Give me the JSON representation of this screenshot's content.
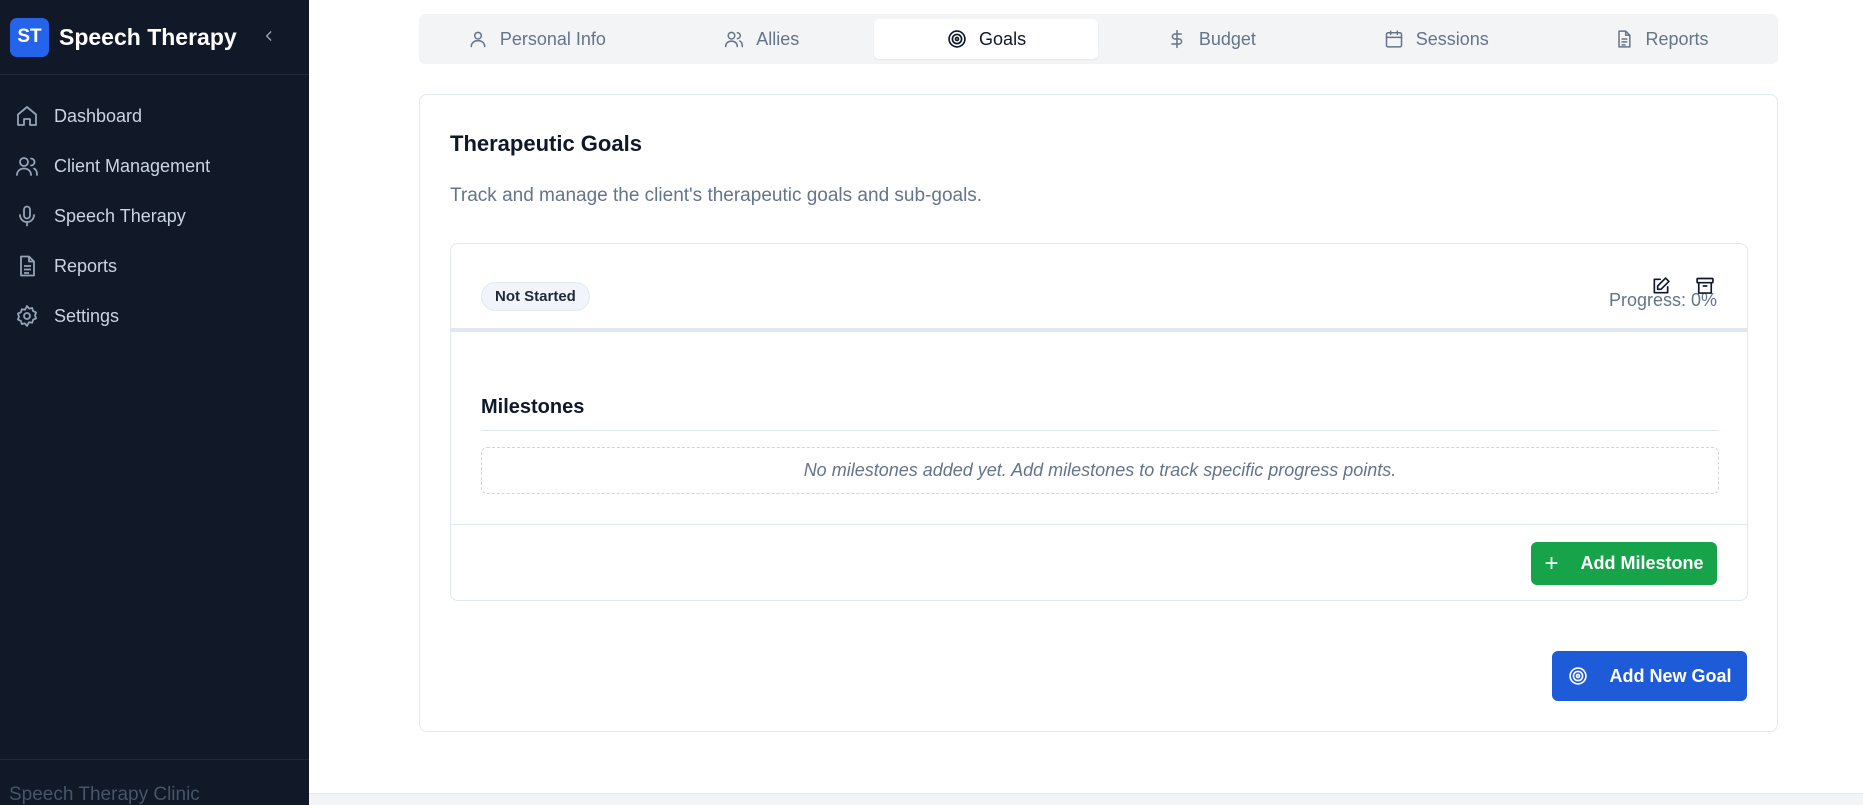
{
  "sidebar": {
    "brand_badge": "ST",
    "brand_title": "Speech Therapy",
    "items": [
      {
        "label": "Dashboard",
        "icon": "home-icon"
      },
      {
        "label": "Client Management",
        "icon": "users-icon"
      },
      {
        "label": "Speech Therapy",
        "icon": "microphone-icon"
      },
      {
        "label": "Reports",
        "icon": "document-icon"
      },
      {
        "label": "Settings",
        "icon": "gear-icon"
      }
    ],
    "footer": "Speech Therapy Clinic"
  },
  "tabs": [
    {
      "label": "Personal Info",
      "icon": "user-icon"
    },
    {
      "label": "Allies",
      "icon": "users-icon"
    },
    {
      "label": "Goals",
      "icon": "target-icon",
      "active": true
    },
    {
      "label": "Budget",
      "icon": "dollar-icon"
    },
    {
      "label": "Sessions",
      "icon": "calendar-icon"
    },
    {
      "label": "Reports",
      "icon": "document-icon"
    }
  ],
  "goals": {
    "title": "Therapeutic Goals",
    "description": "Track and manage the client's therapeutic goals and sub-goals.",
    "goal": {
      "status": "Not Started",
      "progress_label": "Progress: 0%",
      "progress_value": 0,
      "milestones_title": "Milestones",
      "milestones_empty": "No milestones added yet. Add milestones to track specific progress points.",
      "add_milestone_label": "Add Milestone"
    },
    "add_goal_label": "Add New Goal"
  },
  "colors": {
    "sidebar_bg": "#111827",
    "brand_blue": "#2563eb",
    "add_milestone_green": "#16a34a",
    "add_goal_blue": "#1d5bd8"
  }
}
